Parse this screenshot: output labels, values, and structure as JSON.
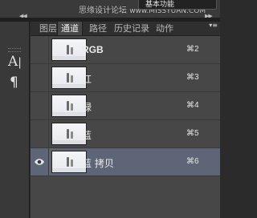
{
  "topbar": {
    "workspace": "基本功能",
    "watermark": "思缘设计论坛",
    "watermark_url": "www.MISSYUAN.COM",
    "collapse_glyph": "◀◀",
    "collapse_glyph_right": "▶▶"
  },
  "toolstrip": {
    "char_glyph": "A",
    "char_bar": "|",
    "para_glyph": "¶"
  },
  "tabs": [
    {
      "label": "图层",
      "active": false
    },
    {
      "label": "通道",
      "active": true
    },
    {
      "label": "路径",
      "active": false
    },
    {
      "label": "历史记录",
      "active": false
    },
    {
      "label": "动作",
      "active": false
    }
  ],
  "panel_menu_glyph": "▾≡",
  "channels": [
    {
      "name": "RGB",
      "shortcut": "⌘2",
      "visible": false,
      "selected": false
    },
    {
      "name": "红",
      "shortcut": "⌘3",
      "visible": false,
      "selected": false
    },
    {
      "name": "绿",
      "shortcut": "⌘4",
      "visible": false,
      "selected": false
    },
    {
      "name": "蓝",
      "shortcut": "⌘5",
      "visible": false,
      "selected": false
    },
    {
      "name": "蓝 拷贝",
      "shortcut": "⌘6",
      "visible": true,
      "selected": true
    }
  ],
  "colors": {
    "selected_row": "#5d6577",
    "panel_bg": "#474747"
  }
}
